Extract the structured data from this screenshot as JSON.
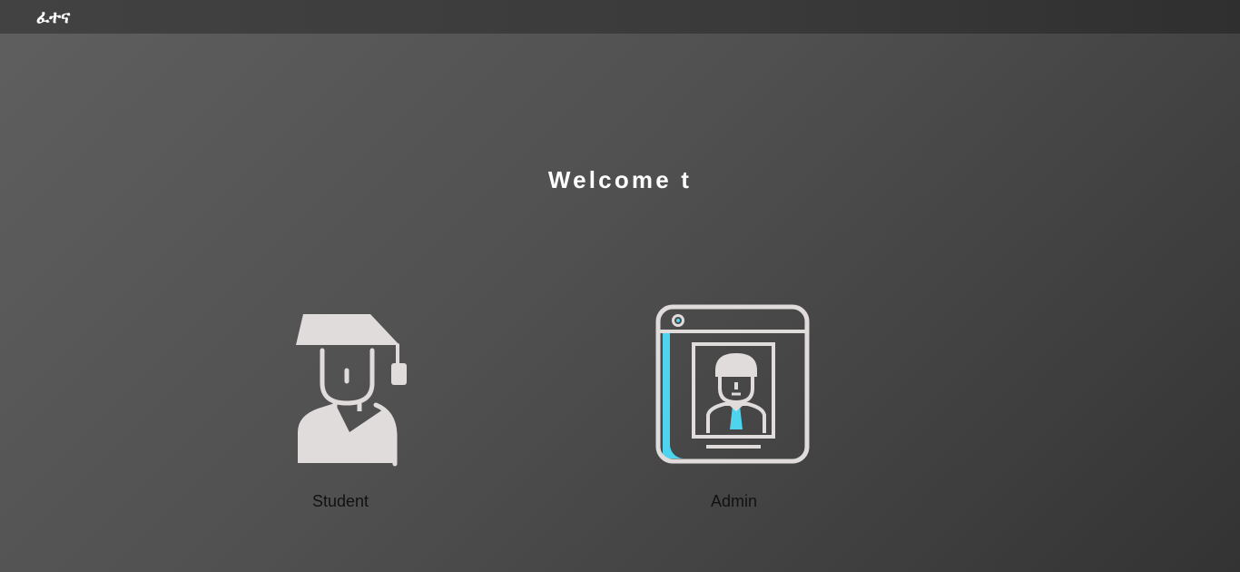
{
  "header": {
    "brand": "ፈተና"
  },
  "main": {
    "welcome_text": "Welcome t"
  },
  "roles": [
    {
      "label": "Student",
      "icon": "graduate-student-icon"
    },
    {
      "label": "Admin",
      "icon": "admin-profile-icon"
    }
  ],
  "colors": {
    "icon_stroke": "#e0dcdc",
    "accent": "#4fd4ee",
    "heading": "#ffffff",
    "label": "#111111"
  }
}
